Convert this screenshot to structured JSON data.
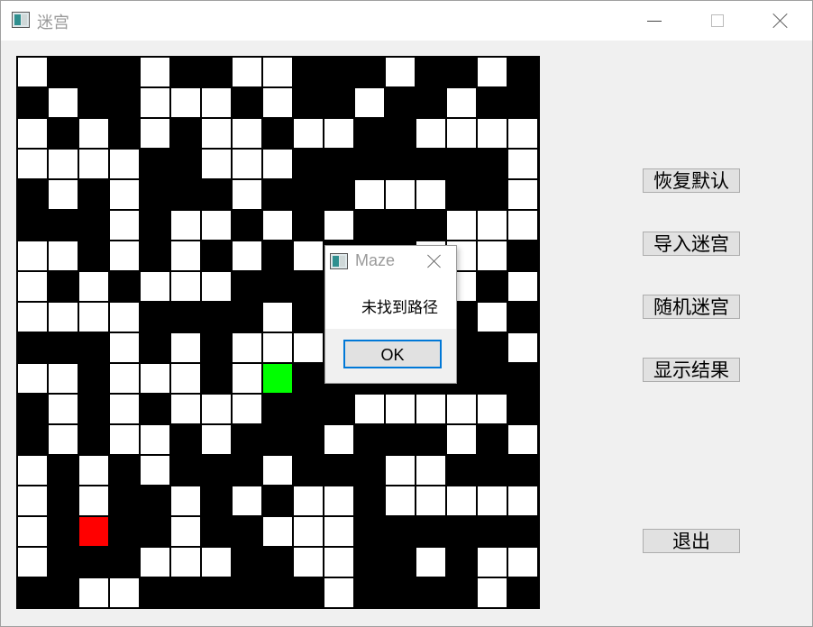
{
  "window": {
    "title": "迷宫",
    "icon": "app-window-icon"
  },
  "controls": {
    "reset_label": "恢复默认",
    "import_label": "导入迷宫",
    "random_label": "随机迷宫",
    "show_label": "显示结果",
    "exit_label": "退出"
  },
  "dialog": {
    "title": "Maze",
    "message": "未找到路径",
    "ok_label": "OK"
  },
  "maze": {
    "rows": 18,
    "cols": 17,
    "colors": {
      "wall": "#000000",
      "path": "#ffffff",
      "start": "#ff0000",
      "end": "#00ff00"
    },
    "start": [
      15,
      2
    ],
    "end": [
      10,
      8
    ],
    "grid": [
      "1000100110001001",
      "01001110100100100",
      "10101011011001111",
      "11110011100000001",
      "01010001000111001",
      "00010110101000111",
      "11010101010001110",
      "10101110000001101",
      "11110000101110010",
      "00010101110000001",
      "11011101000000000",
      "01010111000111110",
      "01011010001000101",
      "10101000100011000",
      "10100101011011111",
      "10000100111000000",
      "10001110011001011",
      "00110000001000010"
    ]
  }
}
